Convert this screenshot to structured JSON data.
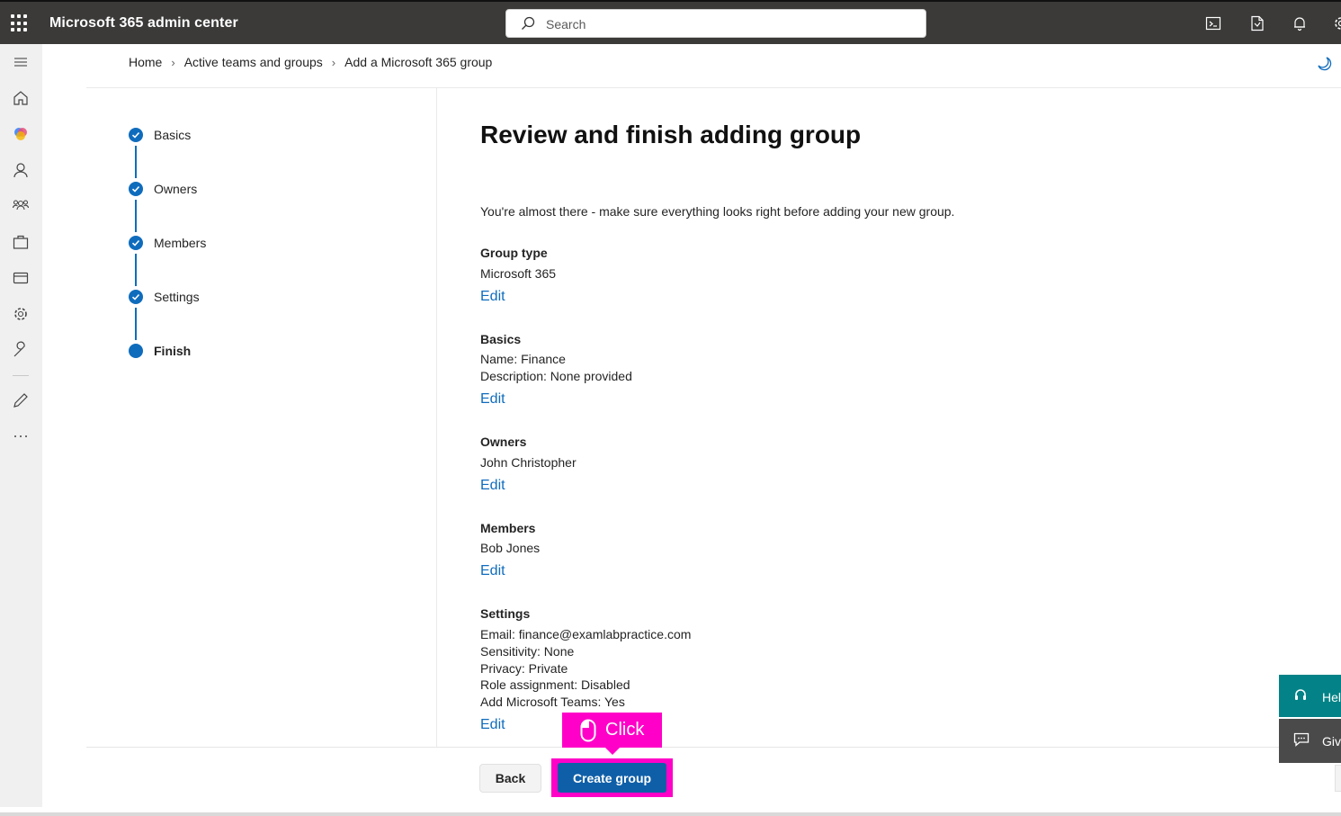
{
  "app": {
    "title": "Microsoft 365 admin center"
  },
  "search": {
    "placeholder": "Search"
  },
  "breadcrumb": [
    "Home",
    "Active teams and groups",
    "Add a Microsoft 365 group"
  ],
  "stepper": {
    "steps": [
      {
        "label": "Basics",
        "state": "completed"
      },
      {
        "label": "Owners",
        "state": "completed"
      },
      {
        "label": "Members",
        "state": "completed"
      },
      {
        "label": "Settings",
        "state": "completed"
      },
      {
        "label": "Finish",
        "state": "current"
      }
    ]
  },
  "main": {
    "title": "Review and finish adding group",
    "intro": "You're almost there - make sure everything looks right before adding your new group.",
    "edit_label": "Edit",
    "sections": {
      "group_type": {
        "heading": "Group type",
        "lines": [
          "Microsoft 365"
        ]
      },
      "basics": {
        "heading": "Basics",
        "lines": [
          "Name: Finance",
          "Description: None provided"
        ]
      },
      "owners": {
        "heading": "Owners",
        "lines": [
          "John Christopher"
        ]
      },
      "members": {
        "heading": "Members",
        "lines": [
          "Bob Jones"
        ]
      },
      "settings": {
        "heading": "Settings",
        "lines": [
          "Email: finance@examlabpractice.com",
          "Sensitivity: None",
          "Privacy: Private",
          "Role assignment: Disabled",
          "Add Microsoft Teams: Yes"
        ]
      }
    }
  },
  "footer": {
    "back_label": "Back",
    "create_label": "Create group"
  },
  "annotation": {
    "click_label": "Click"
  },
  "floating": {
    "help_label": "Hel",
    "feedback_label": "Giv"
  },
  "icons": {
    "top": [
      "app-launcher-icon",
      "search-icon",
      "cloud-shell-icon",
      "document-icon",
      "bell-icon",
      "settings-icon"
    ],
    "rail": [
      "hamburger-menu-icon",
      "home-icon",
      "copilot-icon",
      "user-icon",
      "groups-icon",
      "billing-bag-icon",
      "card-icon",
      "settings-icon",
      "wrench-icon",
      "pencil-icon",
      "more-icon"
    ]
  },
  "colors": {
    "accent": "#0f6cbd",
    "topbar": "#3b3a39",
    "annotation": "#ff00c8",
    "help": "#038387"
  }
}
